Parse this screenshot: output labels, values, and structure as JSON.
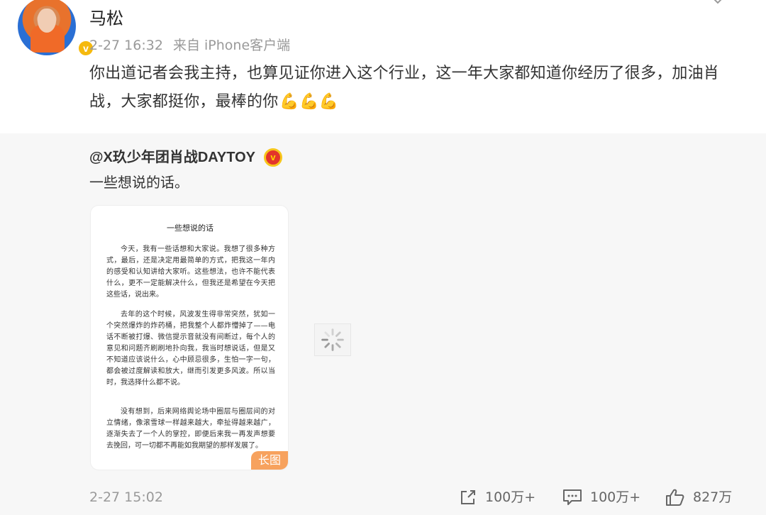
{
  "post": {
    "username": "马松",
    "time": "2-27 16:32",
    "source": "来自 iPhone客户端",
    "text": "你出道记者会我主持，也算见证你进入这个行业，这一年大家都知道你经历了很多，加油肖战，大家都挺你，最棒的你",
    "emoji": "💪💪💪",
    "verified_badge": "v"
  },
  "repost": {
    "author": "@X玖少年团肖战DAYTOY",
    "verified_badge": "v",
    "text": "一些想说的话。",
    "long_image": {
      "title": "一些想说的话",
      "paragraphs": [
        "今天，我有一些话想和大家说。我想了很多种方式，最后，还是决定用最简单的方式，把我这一年内的感受和认知讲给大家听。这些想法，也许不能代表什么，更不一定能解决什么，但我还是希望在今天把这些话，说出来。",
        "去年的这个时候，风波发生得非常突然，犹如一个突然爆炸的炸药桶，把我整个人都炸懵掉了——电话不断被打爆、微信提示音就没有间断过，每个人的意见和问题齐刷刷地扑向我，我当时想说话，但是又不知道应该说什么，心中顾忌很多，生怕一字一句，都会被过度解读和放大，继而引发更多风波。所以当时，我选择什么都不说。",
        "没有想到，后来网络舆论场中圈层与圈层间的对立情绪，像滚雪球一样越来越大，牵扯得越来越广，逐渐失去了一个人的掌控，即便后来我一再发声想要去挽回，可一切都不再能如我期望的那样发展了。"
      ],
      "badge": "长图"
    },
    "time": "2-27 15:02",
    "actions": {
      "share": "100万+",
      "comment": "100万+",
      "like": "827万"
    }
  },
  "colors": {
    "repost_bg": "#f7f7f7",
    "badge_orange": "#f7a25e",
    "gold_v": "#f5b90e",
    "red_v": "#e3352b"
  },
  "icons": [
    "chevron-down-icon",
    "share-icon",
    "comment-icon",
    "like-icon",
    "loading-spinner-icon"
  ]
}
